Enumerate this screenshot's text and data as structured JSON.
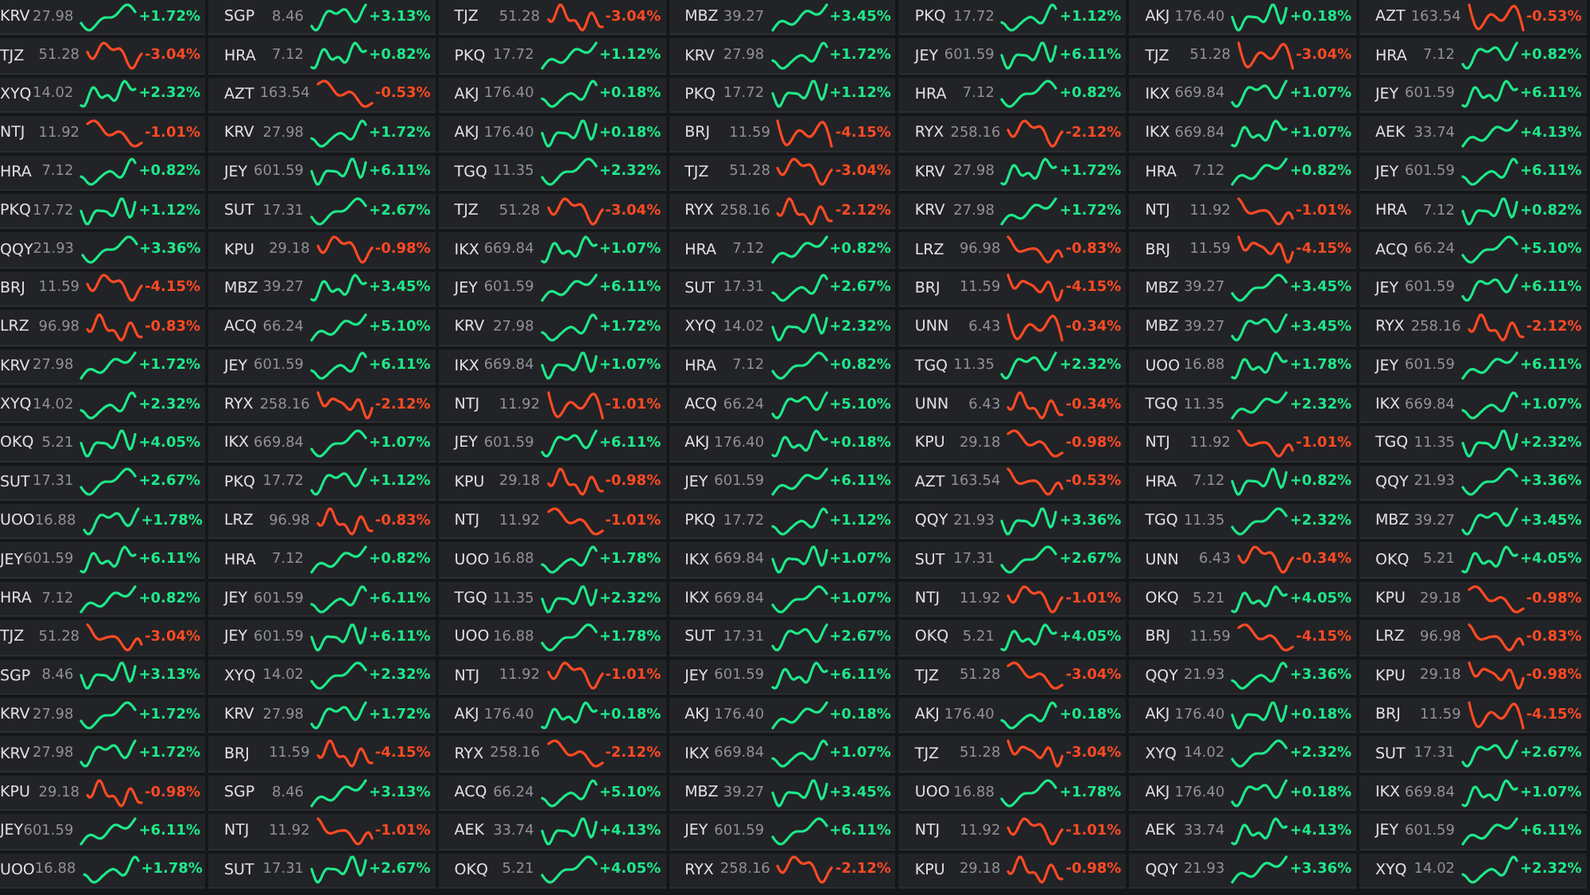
{
  "columns": [
    {
      "cells": [
        {
          "ticker": "KRV",
          "price": "27.98",
          "change": "+1.72%",
          "rising": true
        },
        {
          "ticker": "TJZ",
          "price": "51.28",
          "change": "-3.04%",
          "rising": false
        },
        {
          "ticker": "XYQ",
          "price": "14.02",
          "change": "+2.32%",
          "rising": true
        },
        {
          "ticker": "NTJ",
          "price": "11.92",
          "change": "-1.01%",
          "rising": false
        },
        {
          "ticker": "HRA",
          "price": "7.12",
          "change": "+0.82%",
          "rising": true
        },
        {
          "ticker": "PKQ",
          "price": "17.72",
          "change": "+1.12%",
          "rising": true
        },
        {
          "ticker": "QQY",
          "price": "21.93",
          "change": "+3.36%",
          "rising": true
        },
        {
          "ticker": "BRJ",
          "price": "11.59",
          "change": "-4.15%",
          "rising": false
        },
        {
          "ticker": "LRZ",
          "price": "96.98",
          "change": "-0.83%",
          "rising": false
        },
        {
          "ticker": "KRV",
          "price": "27.98",
          "change": "+1.72%",
          "rising": true
        },
        {
          "ticker": "XYQ",
          "price": "14.02",
          "change": "+2.32%",
          "rising": true
        },
        {
          "ticker": "OKQ",
          "price": "5.21",
          "change": "+4.05%",
          "rising": true
        },
        {
          "ticker": "SUT",
          "price": "17.31",
          "change": "+2.67%",
          "rising": true
        },
        {
          "ticker": "UOO",
          "price": "16.88",
          "change": "+1.78%",
          "rising": true
        },
        {
          "ticker": "JEY",
          "price": "601.59",
          "change": "+6.11%",
          "rising": true
        },
        {
          "ticker": "HRA",
          "price": "7.12",
          "change": "+0.82%",
          "rising": true
        },
        {
          "ticker": "TJZ",
          "price": "51.28",
          "change": "-3.04%",
          "rising": false
        },
        {
          "ticker": "SGP",
          "price": "8.46",
          "change": "+3.13%",
          "rising": true
        },
        {
          "ticker": "KRV",
          "price": "27.98",
          "change": "+1.72%",
          "rising": true
        },
        {
          "ticker": "KRV",
          "price": "27.98",
          "change": "+1.72%",
          "rising": true
        },
        {
          "ticker": "KPU",
          "price": "29.18",
          "change": "-0.98%",
          "rising": false
        },
        {
          "ticker": "JEY",
          "price": "601.59",
          "change": "+6.11%",
          "rising": true
        },
        {
          "ticker": "UOO",
          "price": "16.88",
          "change": "+1.78%",
          "rising": true
        }
      ]
    },
    {
      "cells": [
        {
          "ticker": "SGP",
          "price": "8.46",
          "change": "+3.13%",
          "rising": true
        },
        {
          "ticker": "HRA",
          "price": "7.12",
          "change": "+0.82%",
          "rising": true
        },
        {
          "ticker": "AZT",
          "price": "163.54",
          "change": "-0.53%",
          "rising": false
        },
        {
          "ticker": "KRV",
          "price": "27.98",
          "change": "+1.72%",
          "rising": true
        },
        {
          "ticker": "JEY",
          "price": "601.59",
          "change": "+6.11%",
          "rising": true
        },
        {
          "ticker": "SUT",
          "price": "17.31",
          "change": "+2.67%",
          "rising": true
        },
        {
          "ticker": "KPU",
          "price": "29.18",
          "change": "-0.98%",
          "rising": false
        },
        {
          "ticker": "MBZ",
          "price": "39.27",
          "change": "+3.45%",
          "rising": true
        },
        {
          "ticker": "ACQ",
          "price": "66.24",
          "change": "+5.10%",
          "rising": true
        },
        {
          "ticker": "JEY",
          "price": "601.59",
          "change": "+6.11%",
          "rising": true
        },
        {
          "ticker": "RYX",
          "price": "258.16",
          "change": "-2.12%",
          "rising": false
        },
        {
          "ticker": "IKX",
          "price": "669.84",
          "change": "+1.07%",
          "rising": true
        },
        {
          "ticker": "PKQ",
          "price": "17.72",
          "change": "+1.12%",
          "rising": true
        },
        {
          "ticker": "LRZ",
          "price": "96.98",
          "change": "-0.83%",
          "rising": false
        },
        {
          "ticker": "HRA",
          "price": "7.12",
          "change": "+0.82%",
          "rising": true
        },
        {
          "ticker": "JEY",
          "price": "601.59",
          "change": "+6.11%",
          "rising": true
        },
        {
          "ticker": "JEY",
          "price": "601.59",
          "change": "+6.11%",
          "rising": true
        },
        {
          "ticker": "XYQ",
          "price": "14.02",
          "change": "+2.32%",
          "rising": true
        },
        {
          "ticker": "KRV",
          "price": "27.98",
          "change": "+1.72%",
          "rising": true
        },
        {
          "ticker": "BRJ",
          "price": "11.59",
          "change": "-4.15%",
          "rising": false
        },
        {
          "ticker": "SGP",
          "price": "8.46",
          "change": "+3.13%",
          "rising": true
        },
        {
          "ticker": "NTJ",
          "price": "11.92",
          "change": "-1.01%",
          "rising": false
        },
        {
          "ticker": "SUT",
          "price": "17.31",
          "change": "+2.67%",
          "rising": true
        }
      ]
    },
    {
      "cells": [
        {
          "ticker": "TJZ",
          "price": "51.28",
          "change": "-3.04%",
          "rising": false
        },
        {
          "ticker": "PKQ",
          "price": "17.72",
          "change": "+1.12%",
          "rising": true
        },
        {
          "ticker": "AKJ",
          "price": "176.40",
          "change": "+0.18%",
          "rising": true
        },
        {
          "ticker": "AKJ",
          "price": "176.40",
          "change": "+0.18%",
          "rising": true
        },
        {
          "ticker": "TGQ",
          "price": "11.35",
          "change": "+2.32%",
          "rising": true
        },
        {
          "ticker": "TJZ",
          "price": "51.28",
          "change": "-3.04%",
          "rising": false
        },
        {
          "ticker": "IKX",
          "price": "669.84",
          "change": "+1.07%",
          "rising": true
        },
        {
          "ticker": "JEY",
          "price": "601.59",
          "change": "+6.11%",
          "rising": true
        },
        {
          "ticker": "KRV",
          "price": "27.98",
          "change": "+1.72%",
          "rising": true
        },
        {
          "ticker": "IKX",
          "price": "669.84",
          "change": "+1.07%",
          "rising": true
        },
        {
          "ticker": "NTJ",
          "price": "11.92",
          "change": "-1.01%",
          "rising": false
        },
        {
          "ticker": "JEY",
          "price": "601.59",
          "change": "+6.11%",
          "rising": true
        },
        {
          "ticker": "KPU",
          "price": "29.18",
          "change": "-0.98%",
          "rising": false
        },
        {
          "ticker": "NTJ",
          "price": "11.92",
          "change": "-1.01%",
          "rising": false
        },
        {
          "ticker": "UOO",
          "price": "16.88",
          "change": "+1.78%",
          "rising": true
        },
        {
          "ticker": "TGQ",
          "price": "11.35",
          "change": "+2.32%",
          "rising": true
        },
        {
          "ticker": "UOO",
          "price": "16.88",
          "change": "+1.78%",
          "rising": true
        },
        {
          "ticker": "NTJ",
          "price": "11.92",
          "change": "-1.01%",
          "rising": false
        },
        {
          "ticker": "AKJ",
          "price": "176.40",
          "change": "+0.18%",
          "rising": true
        },
        {
          "ticker": "RYX",
          "price": "258.16",
          "change": "-2.12%",
          "rising": false
        },
        {
          "ticker": "ACQ",
          "price": "66.24",
          "change": "+5.10%",
          "rising": true
        },
        {
          "ticker": "AEK",
          "price": "33.74",
          "change": "+4.13%",
          "rising": true
        },
        {
          "ticker": "OKQ",
          "price": "5.21",
          "change": "+4.05%",
          "rising": true
        }
      ]
    },
    {
      "cells": [
        {
          "ticker": "MBZ",
          "price": "39.27",
          "change": "+3.45%",
          "rising": true
        },
        {
          "ticker": "KRV",
          "price": "27.98",
          "change": "+1.72%",
          "rising": true
        },
        {
          "ticker": "PKQ",
          "price": "17.72",
          "change": "+1.12%",
          "rising": true
        },
        {
          "ticker": "BRJ",
          "price": "11.59",
          "change": "-4.15%",
          "rising": false
        },
        {
          "ticker": "TJZ",
          "price": "51.28",
          "change": "-3.04%",
          "rising": false
        },
        {
          "ticker": "RYX",
          "price": "258.16",
          "change": "-2.12%",
          "rising": false
        },
        {
          "ticker": "HRA",
          "price": "7.12",
          "change": "+0.82%",
          "rising": true
        },
        {
          "ticker": "SUT",
          "price": "17.31",
          "change": "+2.67%",
          "rising": true
        },
        {
          "ticker": "XYQ",
          "price": "14.02",
          "change": "+2.32%",
          "rising": true
        },
        {
          "ticker": "HRA",
          "price": "7.12",
          "change": "+0.82%",
          "rising": true
        },
        {
          "ticker": "ACQ",
          "price": "66.24",
          "change": "+5.10%",
          "rising": true
        },
        {
          "ticker": "AKJ",
          "price": "176.40",
          "change": "+0.18%",
          "rising": true
        },
        {
          "ticker": "JEY",
          "price": "601.59",
          "change": "+6.11%",
          "rising": true
        },
        {
          "ticker": "PKQ",
          "price": "17.72",
          "change": "+1.12%",
          "rising": true
        },
        {
          "ticker": "IKX",
          "price": "669.84",
          "change": "+1.07%",
          "rising": true
        },
        {
          "ticker": "IKX",
          "price": "669.84",
          "change": "+1.07%",
          "rising": true
        },
        {
          "ticker": "SUT",
          "price": "17.31",
          "change": "+2.67%",
          "rising": true
        },
        {
          "ticker": "JEY",
          "price": "601.59",
          "change": "+6.11%",
          "rising": true
        },
        {
          "ticker": "AKJ",
          "price": "176.40",
          "change": "+0.18%",
          "rising": true
        },
        {
          "ticker": "IKX",
          "price": "669.84",
          "change": "+1.07%",
          "rising": true
        },
        {
          "ticker": "MBZ",
          "price": "39.27",
          "change": "+3.45%",
          "rising": true
        },
        {
          "ticker": "JEY",
          "price": "601.59",
          "change": "+6.11%",
          "rising": true
        },
        {
          "ticker": "RYX",
          "price": "258.16",
          "change": "-2.12%",
          "rising": false
        }
      ]
    },
    {
      "cells": [
        {
          "ticker": "PKQ",
          "price": "17.72",
          "change": "+1.12%",
          "rising": true
        },
        {
          "ticker": "JEY",
          "price": "601.59",
          "change": "+6.11%",
          "rising": true
        },
        {
          "ticker": "HRA",
          "price": "7.12",
          "change": "+0.82%",
          "rising": true
        },
        {
          "ticker": "RYX",
          "price": "258.16",
          "change": "-2.12%",
          "rising": false
        },
        {
          "ticker": "KRV",
          "price": "27.98",
          "change": "+1.72%",
          "rising": true
        },
        {
          "ticker": "KRV",
          "price": "27.98",
          "change": "+1.72%",
          "rising": true
        },
        {
          "ticker": "LRZ",
          "price": "96.98",
          "change": "-0.83%",
          "rising": false
        },
        {
          "ticker": "BRJ",
          "price": "11.59",
          "change": "-4.15%",
          "rising": false
        },
        {
          "ticker": "UNN",
          "price": "6.43",
          "change": "-0.34%",
          "rising": false
        },
        {
          "ticker": "TGQ",
          "price": "11.35",
          "change": "+2.32%",
          "rising": true
        },
        {
          "ticker": "UNN",
          "price": "6.43",
          "change": "-0.34%",
          "rising": false
        },
        {
          "ticker": "KPU",
          "price": "29.18",
          "change": "-0.98%",
          "rising": false
        },
        {
          "ticker": "AZT",
          "price": "163.54",
          "change": "-0.53%",
          "rising": false
        },
        {
          "ticker": "QQY",
          "price": "21.93",
          "change": "+3.36%",
          "rising": true
        },
        {
          "ticker": "SUT",
          "price": "17.31",
          "change": "+2.67%",
          "rising": true
        },
        {
          "ticker": "NTJ",
          "price": "11.92",
          "change": "-1.01%",
          "rising": false
        },
        {
          "ticker": "OKQ",
          "price": "5.21",
          "change": "+4.05%",
          "rising": true
        },
        {
          "ticker": "TJZ",
          "price": "51.28",
          "change": "-3.04%",
          "rising": false
        },
        {
          "ticker": "AKJ",
          "price": "176.40",
          "change": "+0.18%",
          "rising": true
        },
        {
          "ticker": "TJZ",
          "price": "51.28",
          "change": "-3.04%",
          "rising": false
        },
        {
          "ticker": "UOO",
          "price": "16.88",
          "change": "+1.78%",
          "rising": true
        },
        {
          "ticker": "NTJ",
          "price": "11.92",
          "change": "-1.01%",
          "rising": false
        },
        {
          "ticker": "KPU",
          "price": "29.18",
          "change": "-0.98%",
          "rising": false
        }
      ]
    },
    {
      "cells": [
        {
          "ticker": "AKJ",
          "price": "176.40",
          "change": "+0.18%",
          "rising": true
        },
        {
          "ticker": "TJZ",
          "price": "51.28",
          "change": "-3.04%",
          "rising": false
        },
        {
          "ticker": "IKX",
          "price": "669.84",
          "change": "+1.07%",
          "rising": true
        },
        {
          "ticker": "IKX",
          "price": "669.84",
          "change": "+1.07%",
          "rising": true
        },
        {
          "ticker": "HRA",
          "price": "7.12",
          "change": "+0.82%",
          "rising": true
        },
        {
          "ticker": "NTJ",
          "price": "11.92",
          "change": "-1.01%",
          "rising": false
        },
        {
          "ticker": "BRJ",
          "price": "11.59",
          "change": "-4.15%",
          "rising": false
        },
        {
          "ticker": "MBZ",
          "price": "39.27",
          "change": "+3.45%",
          "rising": true
        },
        {
          "ticker": "MBZ",
          "price": "39.27",
          "change": "+3.45%",
          "rising": true
        },
        {
          "ticker": "UOO",
          "price": "16.88",
          "change": "+1.78%",
          "rising": true
        },
        {
          "ticker": "TGQ",
          "price": "11.35",
          "change": "+2.32%",
          "rising": true
        },
        {
          "ticker": "NTJ",
          "price": "11.92",
          "change": "-1.01%",
          "rising": false
        },
        {
          "ticker": "HRA",
          "price": "7.12",
          "change": "+0.82%",
          "rising": true
        },
        {
          "ticker": "TGQ",
          "price": "11.35",
          "change": "+2.32%",
          "rising": true
        },
        {
          "ticker": "UNN",
          "price": "6.43",
          "change": "-0.34%",
          "rising": false
        },
        {
          "ticker": "OKQ",
          "price": "5.21",
          "change": "+4.05%",
          "rising": true
        },
        {
          "ticker": "BRJ",
          "price": "11.59",
          "change": "-4.15%",
          "rising": false
        },
        {
          "ticker": "QQY",
          "price": "21.93",
          "change": "+3.36%",
          "rising": true
        },
        {
          "ticker": "AKJ",
          "price": "176.40",
          "change": "+0.18%",
          "rising": true
        },
        {
          "ticker": "XYQ",
          "price": "14.02",
          "change": "+2.32%",
          "rising": true
        },
        {
          "ticker": "AKJ",
          "price": "176.40",
          "change": "+0.18%",
          "rising": true
        },
        {
          "ticker": "AEK",
          "price": "33.74",
          "change": "+4.13%",
          "rising": true
        },
        {
          "ticker": "QQY",
          "price": "21.93",
          "change": "+3.36%",
          "rising": true
        }
      ]
    },
    {
      "cells": [
        {
          "ticker": "AZT",
          "price": "163.54",
          "change": "-0.53%",
          "rising": false
        },
        {
          "ticker": "HRA",
          "price": "7.12",
          "change": "+0.82%",
          "rising": true
        },
        {
          "ticker": "JEY",
          "price": "601.59",
          "change": "+6.11%",
          "rising": true
        },
        {
          "ticker": "AEK",
          "price": "33.74",
          "change": "+4.13%",
          "rising": true
        },
        {
          "ticker": "JEY",
          "price": "601.59",
          "change": "+6.11%",
          "rising": true
        },
        {
          "ticker": "HRA",
          "price": "7.12",
          "change": "+0.82%",
          "rising": true
        },
        {
          "ticker": "ACQ",
          "price": "66.24",
          "change": "+5.10%",
          "rising": true
        },
        {
          "ticker": "JEY",
          "price": "601.59",
          "change": "+6.11%",
          "rising": true
        },
        {
          "ticker": "RYX",
          "price": "258.16",
          "change": "-2.12%",
          "rising": false
        },
        {
          "ticker": "JEY",
          "price": "601.59",
          "change": "+6.11%",
          "rising": true
        },
        {
          "ticker": "IKX",
          "price": "669.84",
          "change": "+1.07%",
          "rising": true
        },
        {
          "ticker": "TGQ",
          "price": "11.35",
          "change": "+2.32%",
          "rising": true
        },
        {
          "ticker": "QQY",
          "price": "21.93",
          "change": "+3.36%",
          "rising": true
        },
        {
          "ticker": "MBZ",
          "price": "39.27",
          "change": "+3.45%",
          "rising": true
        },
        {
          "ticker": "OKQ",
          "price": "5.21",
          "change": "+4.05%",
          "rising": true
        },
        {
          "ticker": "KPU",
          "price": "29.18",
          "change": "-0.98%",
          "rising": false
        },
        {
          "ticker": "LRZ",
          "price": "96.98",
          "change": "-0.83%",
          "rising": false
        },
        {
          "ticker": "KPU",
          "price": "29.18",
          "change": "-0.98%",
          "rising": false
        },
        {
          "ticker": "BRJ",
          "price": "11.59",
          "change": "-4.15%",
          "rising": false
        },
        {
          "ticker": "SUT",
          "price": "17.31",
          "change": "+2.67%",
          "rising": true
        },
        {
          "ticker": "IKX",
          "price": "669.84",
          "change": "+1.07%",
          "rising": true
        },
        {
          "ticker": "JEY",
          "price": "601.59",
          "change": "+6.11%",
          "rising": true
        },
        {
          "ticker": "XYQ",
          "price": "14.02",
          "change": "+2.32%",
          "rising": true
        }
      ]
    }
  ]
}
